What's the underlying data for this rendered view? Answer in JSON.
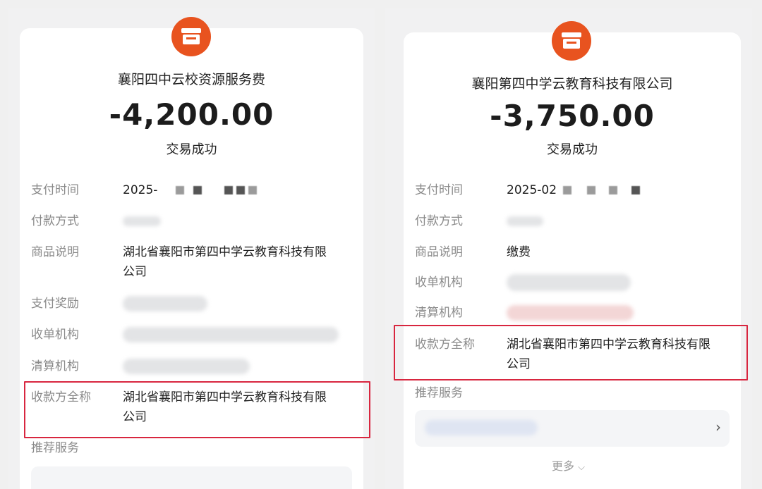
{
  "colors": {
    "brand_orange": "#e8531f",
    "highlight_red": "#d8263f"
  },
  "left": {
    "logo_icon": "storefront-icon",
    "merchant_name": "襄阳四中云校资源服务费",
    "amount": "-4,200.00",
    "status": "交易成功",
    "labels": {
      "pay_time": "支付时间",
      "pay_method": "付款方式",
      "product_desc": "商品说明",
      "pay_reward": "支付奖励",
      "acquirer": "收单机构",
      "clearing": "清算机构",
      "payee_full_name": "收款方全称",
      "recommend": "推荐服务"
    },
    "values": {
      "pay_time_prefix": "2025-",
      "product_desc_line1": "湖北省襄阳市第四中学云教育科技有限",
      "product_desc_line2": "公司",
      "payee_line1": "湖北省襄阳市第四中学云教育科技有限",
      "payee_line2": "公司"
    }
  },
  "right": {
    "logo_icon": "storefront-icon",
    "merchant_name": "襄阳第四中学云教育科技有限公司",
    "amount": "-3,750.00",
    "status": "交易成功",
    "labels": {
      "pay_time": "支付时间",
      "pay_method": "付款方式",
      "product_desc": "商品说明",
      "acquirer": "收单机构",
      "clearing": "清算机构",
      "payee_full_name": "收款方全称",
      "recommend": "推荐服务"
    },
    "values": {
      "pay_time_prefix": "2025-02",
      "product_desc": "缴费",
      "payee_line1": "湖北省襄阳市第四中学云教育科技有限",
      "payee_line2": "公司"
    },
    "more_label": "更多",
    "more_icon": "chevron-down-icon",
    "recommend_arrow_icon": "chevron-right-icon"
  }
}
